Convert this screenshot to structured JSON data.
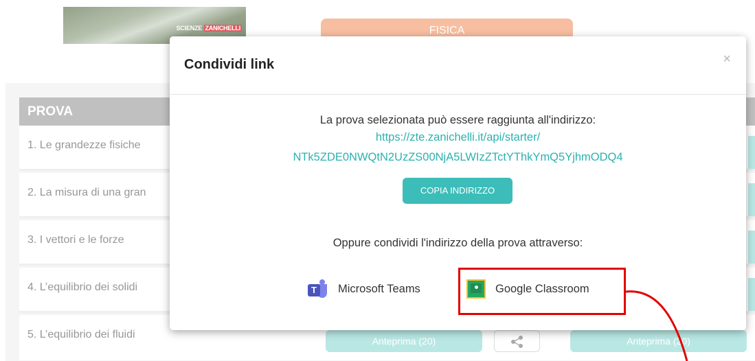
{
  "background": {
    "banner": {
      "series_label": "SCIENZE",
      "brand_label": "ZANICHELLI"
    },
    "subject_pill": "FISICA",
    "list": {
      "header": "PROVA",
      "rows": [
        "1. Le grandezze fisiche",
        "2. La misura di una gran",
        "3. I vettori e le forze",
        "4. L’equilibrio dei solidi",
        "5. L’equilibrio dei fluidi"
      ],
      "preview_label_left": "Anteprima (20)",
      "preview_label_right": "Anteprima (20)"
    }
  },
  "modal": {
    "title": "Condividi link",
    "close_symbol": "×",
    "intro": "La prova selezionata può essere raggiunta all'indirizzo:",
    "link_line1": "https://zte.zanichelli.it/api/starter/",
    "link_line2": "NTk5ZDE0NWQtN2UzZS00NjA5LWIzZTctYThkYmQ5YjhmODQ4",
    "copy_button": "COPIA INDIRIZZO",
    "alt_share": "Oppure condividi l'indirizzo della prova attraverso:",
    "teams_label": "Microsoft Teams",
    "classroom_label": "Google Classroom"
  },
  "colors": {
    "accent": "#3dbdb9",
    "link": "#2bb2b0",
    "subject": "#f4a57d",
    "highlight": "#e30000"
  },
  "icons": [
    "microsoft-teams-icon",
    "google-classroom-icon",
    "share-icon",
    "close-icon"
  ]
}
